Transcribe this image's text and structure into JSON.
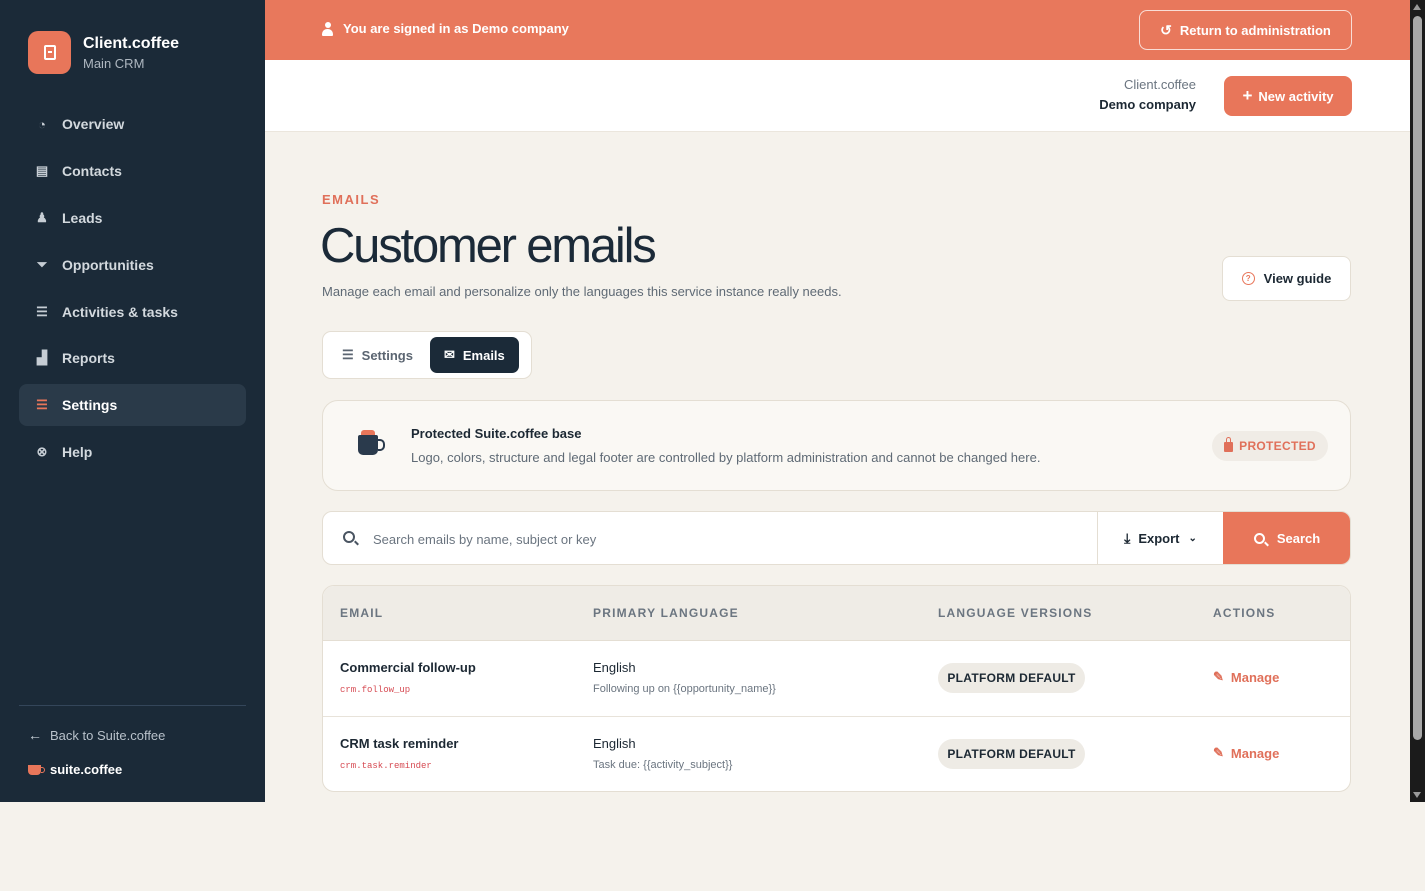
{
  "brand": {
    "name": "Client.coffee",
    "subtitle": "Main CRM"
  },
  "sidebar": {
    "items": [
      {
        "label": "Overview",
        "icon": "pie-chart-icon",
        "glyph": "◔",
        "active": false
      },
      {
        "label": "Contacts",
        "icon": "contact-card-icon",
        "glyph": "▤",
        "active": false
      },
      {
        "label": "Leads",
        "icon": "user-plus-icon",
        "glyph": "♟",
        "active": false
      },
      {
        "label": "Opportunities",
        "icon": "funnel-icon",
        "glyph": "⏷",
        "active": false
      },
      {
        "label": "Activities & tasks",
        "icon": "list-icon",
        "glyph": "☰",
        "active": false
      },
      {
        "label": "Reports",
        "icon": "bar-chart-icon",
        "glyph": "▟",
        "active": false
      },
      {
        "label": "Settings",
        "icon": "sliders-icon",
        "glyph": "☰",
        "active": true
      },
      {
        "label": "Help",
        "icon": "lifebuoy-icon",
        "glyph": "⊗",
        "active": false
      }
    ],
    "back_label": "Back to Suite.coffee",
    "footer_brand": "suite.coffee"
  },
  "banner": {
    "message": "You are signed in as Demo company",
    "return_label": "Return to administration"
  },
  "topbar": {
    "company_top": "Client.coffee",
    "company_bottom": "Demo company",
    "new_activity_label": "New activity"
  },
  "page": {
    "eyebrow": "EMAILS",
    "title": "Customer emails",
    "description": "Manage each email and personalize only the languages this service instance really needs.",
    "view_guide_label": "View guide"
  },
  "tabs": [
    {
      "label": "Settings",
      "active": false
    },
    {
      "label": "Emails",
      "active": true
    }
  ],
  "protected": {
    "title": "Protected Suite.coffee base",
    "description": "Logo, colors, structure and legal footer are controlled by platform administration and cannot be changed here.",
    "badge": "PROTECTED"
  },
  "search": {
    "placeholder": "Search emails by name, subject or key",
    "export_label": "Export",
    "search_label": "Search"
  },
  "table": {
    "columns": [
      "EMAIL",
      "PRIMARY LANGUAGE",
      "LANGUAGE VERSIONS",
      "ACTIONS"
    ],
    "rows": [
      {
        "name": "Commercial follow-up",
        "key": "crm.follow_up",
        "language": "English",
        "subject": "Following up on {{opportunity_name}}",
        "versions": "PLATFORM DEFAULT",
        "action": "Manage"
      },
      {
        "name": "CRM task reminder",
        "key": "crm.task.reminder",
        "language": "English",
        "subject": "Task due: {{activity_subject}}",
        "versions": "PLATFORM DEFAULT",
        "action": "Manage"
      }
    ]
  },
  "colors": {
    "accent": "#e8765a",
    "sidebar_bg": "#1b2a38",
    "page_bg": "#f5f2ec"
  }
}
